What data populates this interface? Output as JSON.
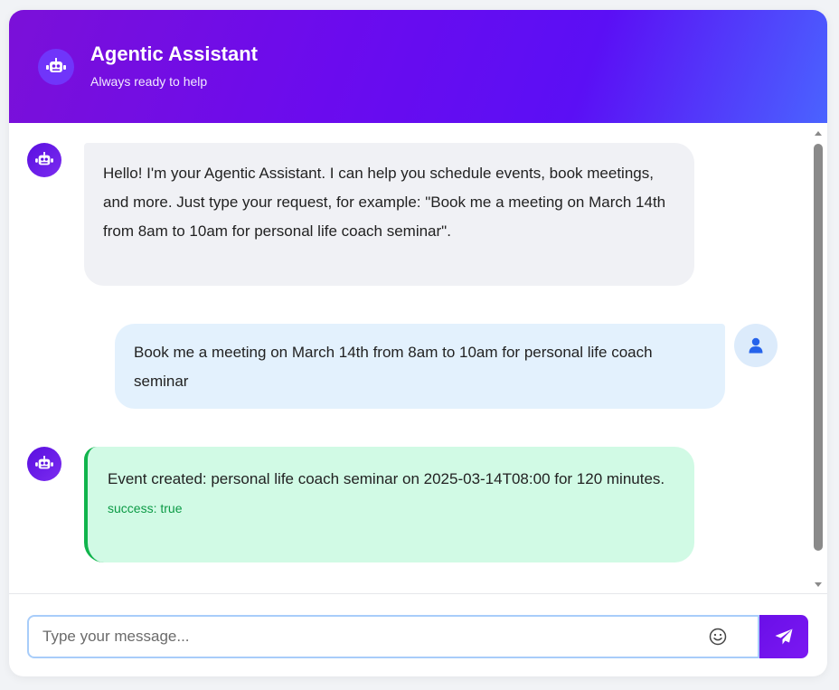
{
  "header": {
    "title": "Agentic Assistant",
    "subtitle": "Always ready to help",
    "avatar_icon": "robot-icon"
  },
  "messages": [
    {
      "sender": "bot",
      "text": "Hello! I'm your Agentic Assistant. I can help you schedule events, book meetings, and more. Just type your request, for example: \"Book me a meeting on March 14th from 8am to 10am for personal life coach seminar\"."
    },
    {
      "sender": "user",
      "text": "Book me a meeting on March 14th from 8am to 10am for personal life coach seminar"
    },
    {
      "sender": "bot",
      "text": "Event created: personal life coach seminar on 2025-03-14T08:00 for 120 minutes.",
      "status": "success: true"
    }
  ],
  "composer": {
    "placeholder": "Type your message...",
    "value": "",
    "emoji_icon": "smiley-icon",
    "send_icon": "paper-plane-icon"
  },
  "colors": {
    "header_gradient_start": "#7b10d8",
    "header_gradient_end": "#4a63ff",
    "bot_bubble": "#f0f1f5",
    "user_bubble": "#e3f1fd",
    "success_bubble": "#d1fae5",
    "success_accent": "#10b44c"
  }
}
